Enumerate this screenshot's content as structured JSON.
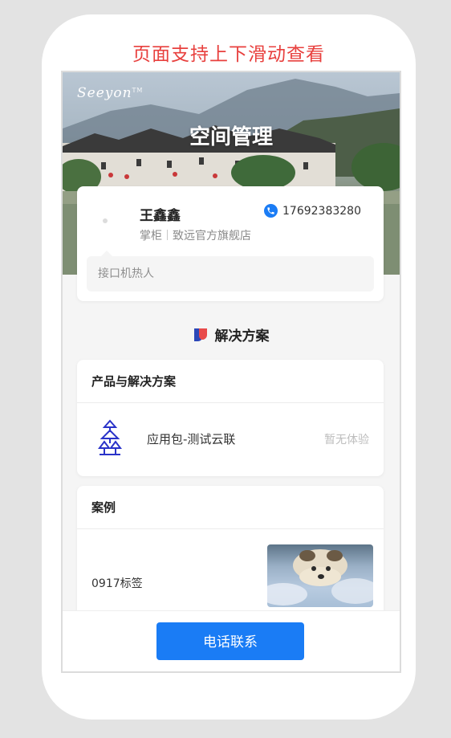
{
  "hint": "页面支持上下滑动查看",
  "header": {
    "logo_text": "Seeyon",
    "logo_tm": "TM",
    "title": "空间管理"
  },
  "profile": {
    "name": "王鑫鑫",
    "phone": "17692383280",
    "role": "掌柜",
    "store": "致远官方旗舰店",
    "intro": "接口机热人"
  },
  "solutions": {
    "heading": "解决方案"
  },
  "products": {
    "title": "产品与解决方案",
    "items": [
      {
        "name": "应用包-测试云联",
        "status": "暂无体验",
        "icon": "tree-logo-icon"
      }
    ]
  },
  "cases": {
    "title": "案例",
    "items": [
      {
        "name": "0917标签",
        "thumbnail": "case-thumbnail"
      }
    ]
  },
  "footer": {
    "call_label": "电话联系"
  },
  "colors": {
    "accent": "#1a7cf5",
    "hint": "#e8403e",
    "badge_red": "#e84a4a",
    "badge_blue": "#2b47b8"
  }
}
